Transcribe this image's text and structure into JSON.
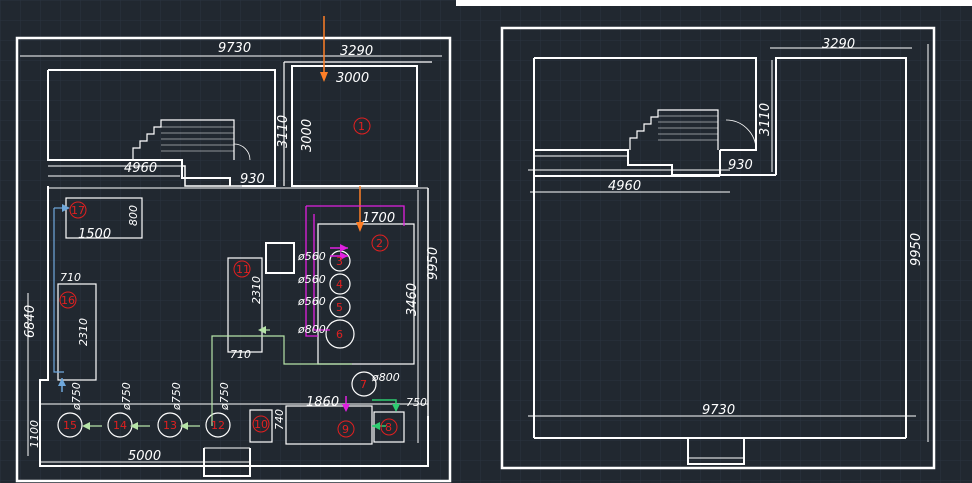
{
  "colors": {
    "background": "#212830",
    "grid": "#2b3440",
    "lines": "#ffffff",
    "labels": "#e02020",
    "pipe_orange": "#ff7f27",
    "pipe_magenta": "#e020e0",
    "pipe_blue": "#6fa8dc",
    "pipe_green": "#2ecc71",
    "pipe_lightgreen": "#b6e3a8"
  },
  "left_plan": {
    "dims": {
      "overall_width": "9730",
      "right_width": "3290",
      "room1_width": "3000",
      "room1_height": "3000",
      "room1_height_outer": "3110",
      "stair_width": "4960",
      "door_930": "930",
      "height_9950": "9950",
      "height_6840": "6840",
      "bottom_5000": "5000",
      "d_1700": "1700",
      "d_3460": "3460",
      "d_1500": "1500",
      "d_800": "800",
      "d_710_a": "710",
      "d_2310_a": "2310",
      "d_710_b": "710",
      "d_2310_b": "2310",
      "d_1860": "1860",
      "d_740": "740",
      "d_750": "750",
      "d_1100": "1100",
      "d_ph800": "ø800",
      "d_ph560_1": "ø560",
      "d_ph560_2": "ø560",
      "d_ph560_3": "ø560",
      "d_ph800_b": "ø800",
      "d_ph750_1": "ø750",
      "d_ph750_2": "ø750",
      "d_ph750_3": "ø750",
      "d_ph750_4": "ø750"
    },
    "equipment": {
      "n1": "1",
      "n2": "2",
      "n3": "3",
      "n4": "4",
      "n5": "5",
      "n6": "6",
      "n7": "7",
      "n8": "8",
      "n9": "9",
      "n10": "10",
      "n11": "11",
      "n12": "12",
      "n13": "13",
      "n14": "14",
      "n15": "15",
      "n16": "16",
      "n17": "17"
    }
  },
  "right_plan": {
    "dims": {
      "right_width": "3290",
      "height_3110": "3110",
      "door_930": "930",
      "stair_width": "4960",
      "height_9950": "9950",
      "overall_width": "9730"
    }
  }
}
